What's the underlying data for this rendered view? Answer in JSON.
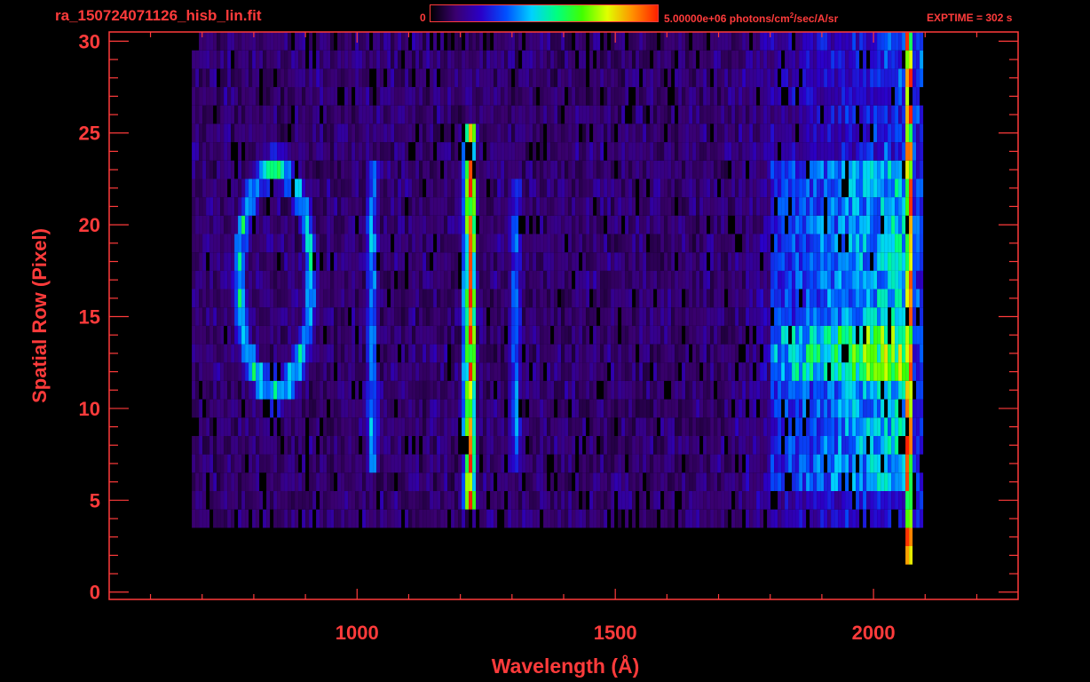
{
  "header": {
    "filename": "ra_150724071126_hisb_lin.fit",
    "colorbar_min": "0",
    "colorbar_max_text": "5.00000e+06 photons/cm",
    "colorbar_max_exp": "2",
    "colorbar_max_suffix": "/sec/A/sr",
    "exptime": "EXPTIME = 302 s"
  },
  "colors": {
    "axis": "#ff3b3b",
    "background": "#000000",
    "colormap": [
      "#000000",
      "#3a0070",
      "#2a00c8",
      "#0050ff",
      "#00d0ff",
      "#00ff80",
      "#40ff00",
      "#e0ff00",
      "#ff9000",
      "#ff2000"
    ]
  },
  "chart_data": {
    "type": "heatmap",
    "xlabel": "Wavelength (Å)",
    "ylabel": "Spatial Row (Pixel)",
    "xlim": [
      520,
      2280
    ],
    "ylim": [
      -0.4,
      30.5
    ],
    "x_ticks": [
      1000,
      1500,
      2000
    ],
    "y_ticks": [
      0,
      5,
      10,
      15,
      20,
      25,
      30
    ],
    "colorscale_range": [
      0,
      5000000
    ],
    "colorscale_units": "photons/cm^2/sec/A/sr",
    "data_x_range": [
      680,
      2090
    ],
    "rows": 31,
    "features": [
      {
        "type": "ring",
        "center_x": 838,
        "center_row": 17,
        "rx_angstrom": 70,
        "ry_rows": 6,
        "level": 0.55
      },
      {
        "type": "line",
        "x": 1216,
        "rows": [
          5,
          25
        ],
        "level": 0.95
      },
      {
        "type": "line",
        "x": 1026,
        "rows": [
          7,
          23
        ],
        "level": 0.45
      },
      {
        "type": "line",
        "x": 1304,
        "rows": [
          7,
          22
        ],
        "level": 0.4
      },
      {
        "type": "band",
        "x": [
          1800,
          2060
        ],
        "rows": [
          6,
          23
        ],
        "level": 0.5
      },
      {
        "type": "band",
        "x": [
          1800,
          2060
        ],
        "rows": [
          12,
          14
        ],
        "level": 0.75
      },
      {
        "type": "edge",
        "x": 2065,
        "rows": [
          2,
          30
        ],
        "level": 0.9
      }
    ]
  }
}
